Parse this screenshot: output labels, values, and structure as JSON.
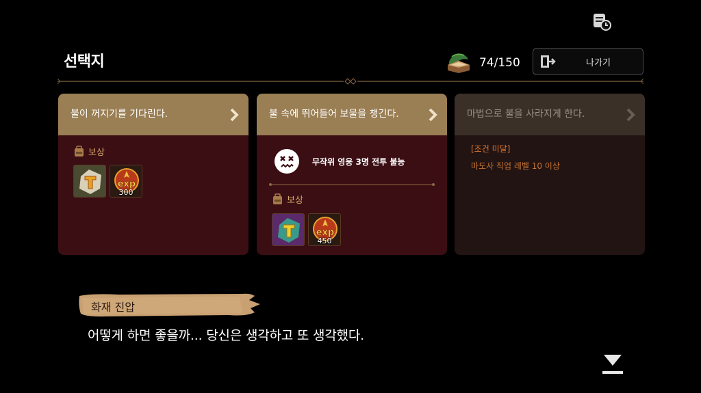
{
  "header": {
    "title": "선택지",
    "stamina": "74/150",
    "exit_label": "나가기"
  },
  "choices": [
    {
      "label": "불이 꺼지기를 기다린다.",
      "reward_label": "보상",
      "rewards": [
        {
          "icon": "rune-t-icon",
          "count": ""
        },
        {
          "icon": "exp-icon",
          "count": "300"
        }
      ]
    },
    {
      "label": "불 속에 뛰어들어 보물을 챙긴다.",
      "penalty": "무작위 영웅 3명 전투 불능",
      "reward_label": "보상",
      "rewards": [
        {
          "icon": "rune-t-purple-icon",
          "count": ""
        },
        {
          "icon": "exp-icon",
          "count": "450"
        }
      ]
    },
    {
      "label": "마법으로 불을 사라지게 한다.",
      "condition_title": "[조건 미달]",
      "condition_text": "마도사 직업 레벨 10 이상"
    }
  ],
  "dialogue": {
    "speaker": "화재 진압",
    "text": "어떻게 하면 좋을까... 당신은 생각하고 또 생각했다."
  },
  "colors": {
    "card_header": "#9a7e54",
    "card_body": "#3b0e14",
    "disabled_body": "#231414",
    "reward_text": "#d6a86a",
    "condition_text": "#e07a2c"
  }
}
